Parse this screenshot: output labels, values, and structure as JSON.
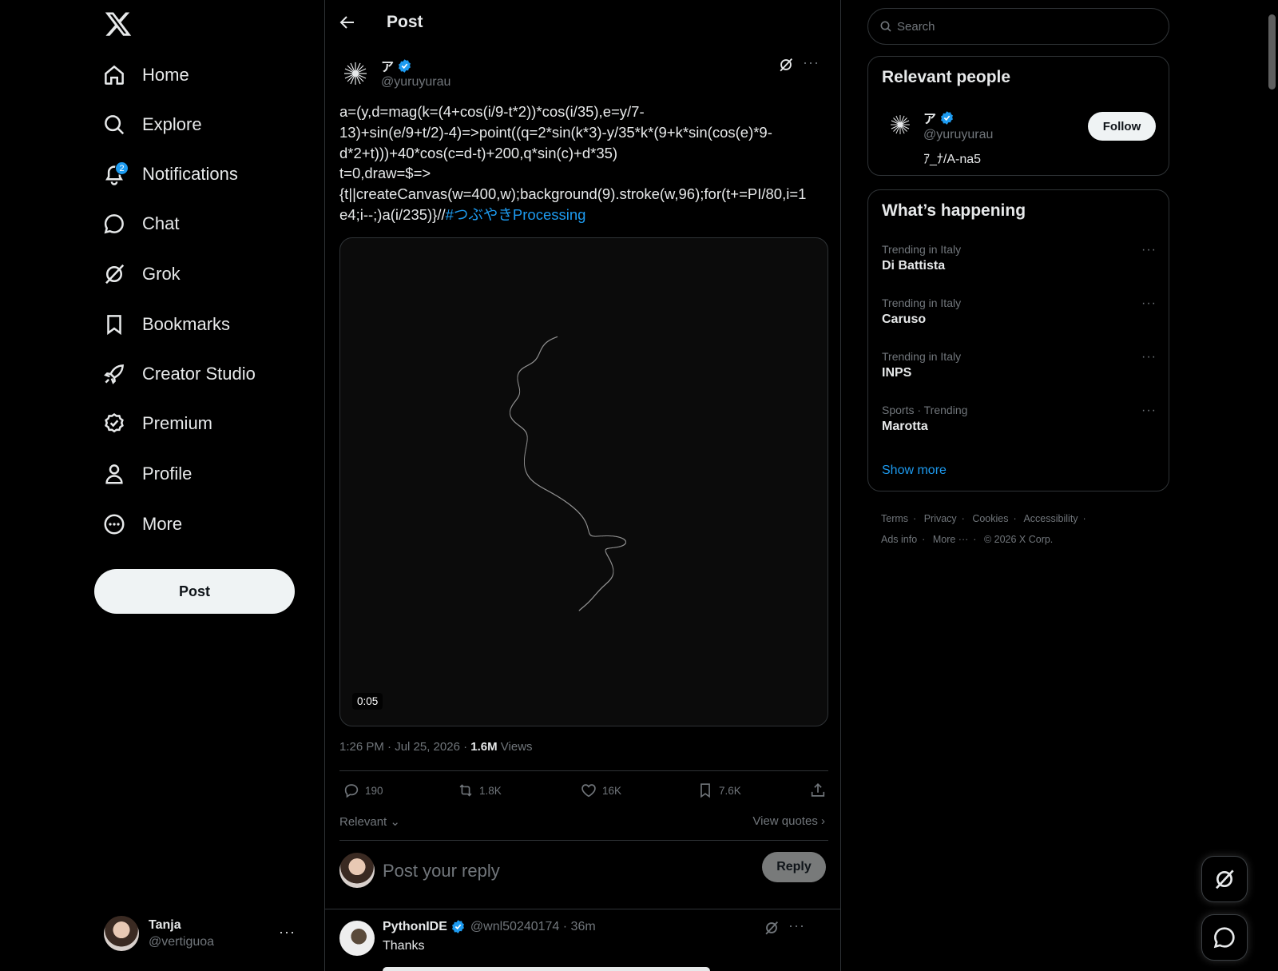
{
  "nav": {
    "items": [
      {
        "label": "Home",
        "icon": "home-icon"
      },
      {
        "label": "Explore",
        "icon": "search-icon"
      },
      {
        "label": "Notifications",
        "icon": "bell-icon",
        "badge": "2"
      },
      {
        "label": "Chat",
        "icon": "chat-icon"
      },
      {
        "label": "Grok",
        "icon": "grok-icon"
      },
      {
        "label": "Bookmarks",
        "icon": "bookmark-icon"
      },
      {
        "label": "Creator Studio",
        "icon": "rocket-icon"
      },
      {
        "label": "Premium",
        "icon": "premium-icon"
      },
      {
        "label": "Profile",
        "icon": "person-icon"
      },
      {
        "label": "More",
        "icon": "more-circle-icon"
      }
    ],
    "post_label": "Post",
    "account": {
      "name": "Tanja",
      "handle": "@vertiguoa",
      "more": "···"
    }
  },
  "header": {
    "title": "Post"
  },
  "post": {
    "author_name": "ア",
    "author_handle": "@yuruyurau",
    "more": "···",
    "text_lines": [
      "a=(y,d=mag(k=(4+cos(i/9-t*2))*cos(i/35),e=y/7-",
      "13)+sin(e/9+t/2)-4)=>point((q=2*sin(k*3)-y/35*k*(9+k*sin(cos(e)*9-",
      "d*2+t)))+40*cos(c=d-t)+200,q*sin(c)+d*35)",
      "t=0,draw=$=>",
      "{t||createCanvas(w=400,w);background(9).stroke(w,96);for(t+=PI/80,i=1",
      "e4;i--;)a(i/235)}//"
    ],
    "hashtags": "#つぶやきProcessing",
    "video_duration": "0:05",
    "time": "1:26 PM · Jul 25, 2026 · ",
    "views_count": "1.6M",
    "views_label": " Views",
    "stats": {
      "replies": "190",
      "reposts": "1.8K",
      "likes": "16K",
      "bookmarks": "7.6K"
    },
    "sort_label": "Relevant",
    "view_quotes": "View quotes"
  },
  "composer": {
    "placeholder": "Post your reply",
    "reply_label": "Reply"
  },
  "reply": {
    "name": "PythonIDE",
    "handle_time": "@wnl50240174 · 36m",
    "text": "Thanks",
    "more": "···"
  },
  "search": {
    "placeholder": "Search"
  },
  "relevant_people": {
    "title": "Relevant people",
    "name": "ア",
    "handle": "@yuruyurau",
    "bio": "ｱ_ﾅ/A-na5",
    "follow_label": "Follow"
  },
  "happening": {
    "title": "What’s happening",
    "trends": [
      {
        "context": "Trending in Italy",
        "name": "Di Battista"
      },
      {
        "context": "Trending in Italy",
        "name": "Caruso"
      },
      {
        "context": "Trending in Italy",
        "name": "INPS"
      },
      {
        "context": "Sports · Trending",
        "name": "Marotta"
      }
    ],
    "trend_more": "···",
    "show_more": "Show more"
  },
  "footer": {
    "links": [
      "Terms",
      "Privacy",
      "Cookies",
      "Accessibility",
      "Ads info",
      "More ···",
      "© 2026 X Corp."
    ],
    "separator": "·"
  },
  "colors": {
    "accent": "#1d9bf0",
    "background": "#000000",
    "border": "#2f3336",
    "muted": "#71767b",
    "text": "#e7e9ea"
  }
}
